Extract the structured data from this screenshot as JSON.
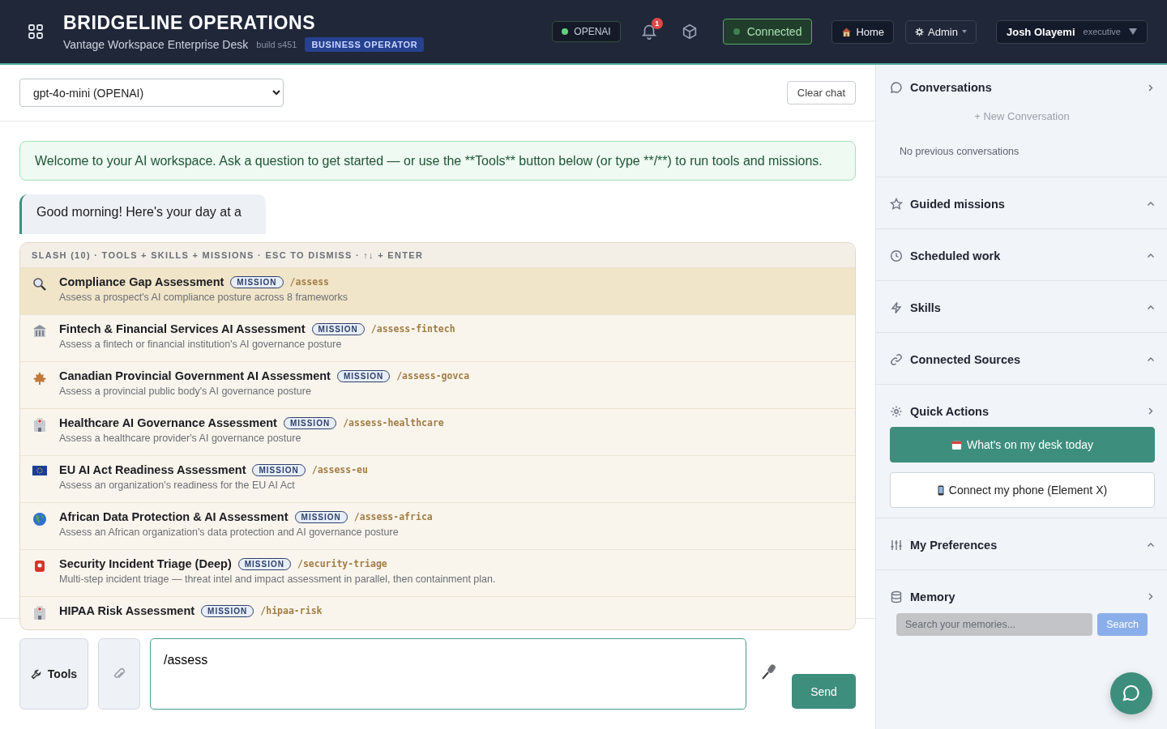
{
  "header": {
    "title": "BRIDGELINE OPERATIONS",
    "subtitle": "Vantage Workspace Enterprise Desk",
    "build": "build s451",
    "role_badge": "BUSINESS OPERATOR",
    "provider": "OPENAI",
    "notifications": "1",
    "connection": {
      "label": "Connected",
      "on": true
    },
    "home": "Home",
    "admin": "Admin",
    "user": {
      "name": "Josh Olayemi",
      "role": "executive"
    }
  },
  "chat": {
    "model": "gpt-4o-mini (OPENAI)",
    "clear": "Clear chat",
    "welcome": "Welcome to your AI workspace. Ask a question to get started — or use the **Tools** button below (or type **/**) to run tools and missions.",
    "greeting": "Good morning! Here's your day at a"
  },
  "slash_menu": {
    "header": "SLASH (10) · TOOLS + SKILLS + MISSIONS · ESC TO DISMISS · ↑↓ + ENTER",
    "items": [
      {
        "title": "Compliance Gap Assessment",
        "tag": "MISSION",
        "command": "/assess",
        "description": "Assess a prospect's AI compliance posture across 8 frameworks",
        "selected": true
      },
      {
        "title": "Fintech & Financial Services AI Assessment",
        "tag": "MISSION",
        "command": "/assess-fintech",
        "description": "Assess a fintech or financial institution's AI governance posture",
        "selected": false
      },
      {
        "title": "Canadian Provincial Government AI Assessment",
        "tag": "MISSION",
        "command": "/assess-govca",
        "description": "Assess a provincial public body's AI governance posture",
        "selected": false
      },
      {
        "title": "Healthcare AI Governance Assessment",
        "tag": "MISSION",
        "command": "/assess-healthcare",
        "description": "Assess a healthcare provider's AI governance posture",
        "selected": false
      },
      {
        "title": "EU AI Act Readiness Assessment",
        "tag": "MISSION",
        "command": "/assess-eu",
        "description": "Assess an organization's readiness for the EU AI Act",
        "selected": false
      },
      {
        "title": "African Data Protection & AI Assessment",
        "tag": "MISSION",
        "command": "/assess-africa",
        "description": "Assess an African organization's data protection and AI governance posture",
        "selected": false
      },
      {
        "title": "Security Incident Triage (Deep)",
        "tag": "MISSION",
        "command": "/security-triage",
        "description": "Multi-step incident triage — threat intel and impact assessment in parallel, then containment plan.",
        "selected": false
      },
      {
        "title": "HIPAA Risk Assessment",
        "tag": "MISSION",
        "command": "/hipaa-risk",
        "selected": false
      }
    ]
  },
  "composer": {
    "tools": "Tools",
    "value": "/assess",
    "send": "Send"
  },
  "sidebar": {
    "sections": [
      {
        "title": "Conversations",
        "expanded": true,
        "kind": "conversations",
        "new": "+ New Conversation",
        "empty": "No previous conversations"
      },
      {
        "title": "Guided missions",
        "expanded": false,
        "kind": "plain"
      },
      {
        "title": "Scheduled work",
        "expanded": false,
        "kind": "plain"
      },
      {
        "title": "Skills",
        "expanded": false,
        "kind": "plain"
      },
      {
        "title": "Connected Sources",
        "expanded": false,
        "kind": "plain"
      },
      {
        "title": "Quick Actions",
        "expanded": true,
        "kind": "actions",
        "actions": [
          "What's on my desk today",
          "Connect my phone (Element X)"
        ]
      },
      {
        "title": "My Preferences",
        "expanded": false,
        "kind": "plain"
      },
      {
        "title": "Memory",
        "expanded": true,
        "kind": "memory",
        "placeholder": "Search your memories...",
        "button": "Search"
      }
    ]
  }
}
